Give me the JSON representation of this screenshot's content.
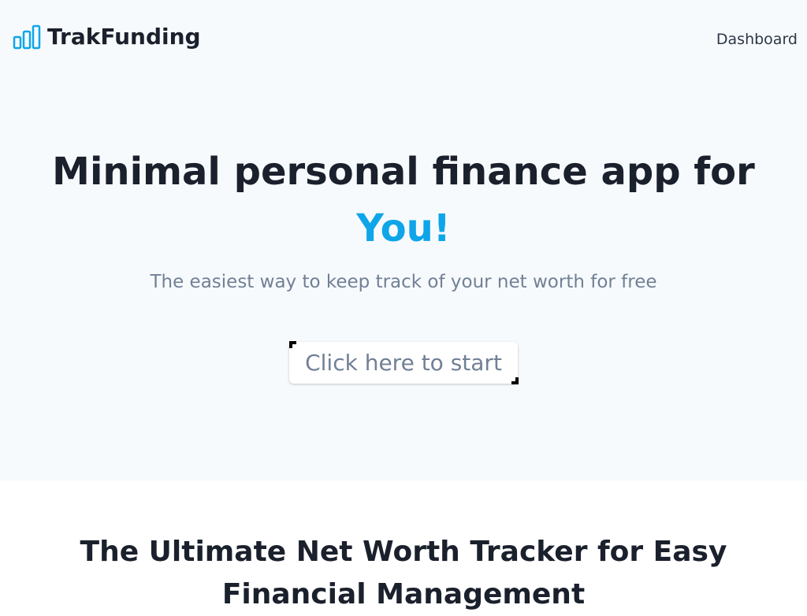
{
  "header": {
    "brand_icon": "bar-chart-icon",
    "brand_name": "TrakFunding",
    "nav": {
      "dashboard_label": "Dashboard"
    }
  },
  "hero": {
    "headline_main": "Minimal personal finance app for",
    "headline_accent": "You!",
    "subline": "The easiest way to keep track of your net worth for free",
    "cta_label": "Click here to start"
  },
  "features": {
    "title": "The Ultimate Net Worth Tracker for Easy Financial Management"
  },
  "colors": {
    "accent": "#0ea5e9",
    "hero_background": "#f7fafc",
    "text_dark": "#1a202c",
    "text_muted": "#718096"
  }
}
